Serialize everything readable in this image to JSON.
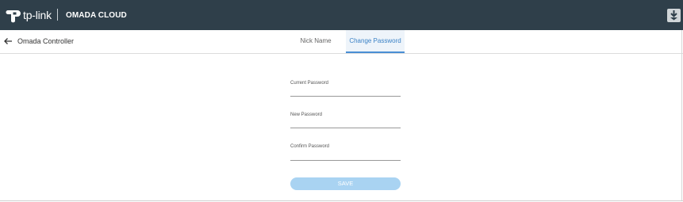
{
  "header": {
    "brand": "tp-link",
    "product": "OMADA CLOUD",
    "logo_icon": "tp-link-logo-icon",
    "download_icon": "download-icon",
    "bar_color": "#2f3f4a"
  },
  "subheader": {
    "back_icon": "arrow-left-icon",
    "title": "Omada Controller",
    "tabs": [
      {
        "label": "Nick Name",
        "active": false
      },
      {
        "label": "Change Password",
        "active": true
      }
    ]
  },
  "form": {
    "current_password_label": "Current Password",
    "new_password_label": "New Password",
    "confirm_password_label": "Confirm Password",
    "current_password_value": "",
    "new_password_value": "",
    "confirm_password_value": "",
    "save_label": "SAVE",
    "save_color": "#a9d3f2",
    "accent_color": "#4a8fd4"
  }
}
